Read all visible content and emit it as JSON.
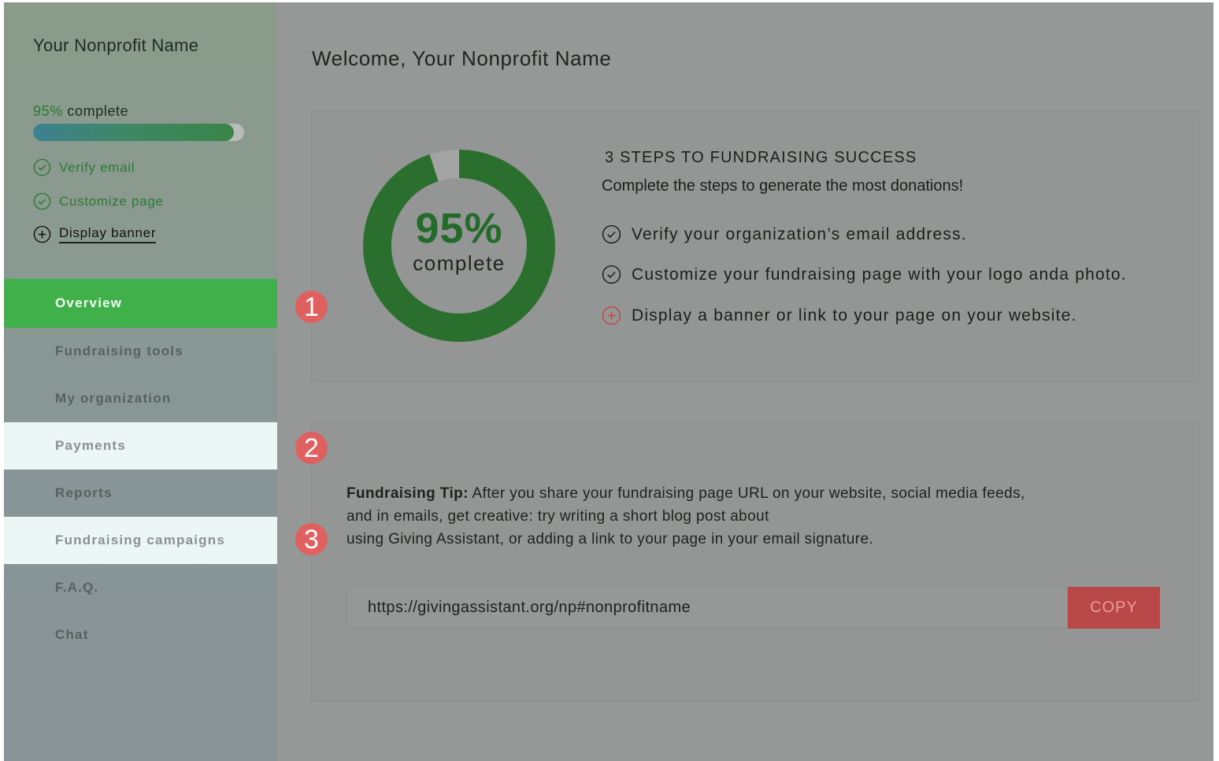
{
  "sidebar": {
    "org_name": "Your Nonprofit Name",
    "progress": {
      "percent_label": "95%",
      "suffix": " complete",
      "value": 0.95
    },
    "steps": [
      {
        "label": "Verify email",
        "status": "done",
        "icon": "check-circle-icon"
      },
      {
        "label": "Customize page",
        "status": "done",
        "icon": "check-circle-icon"
      },
      {
        "label": "Display banner",
        "status": "todo",
        "icon": "plus-circle-icon"
      }
    ],
    "nav": [
      {
        "label": "Overview",
        "state": "active"
      },
      {
        "label": "Fundraising tools",
        "state": "normal"
      },
      {
        "label": "My organization",
        "state": "normal"
      },
      {
        "label": "Payments",
        "state": "highlight"
      },
      {
        "label": "Reports",
        "state": "normal"
      },
      {
        "label": "Fundraising campaigns",
        "state": "highlight"
      },
      {
        "label": "F.A.Q.",
        "state": "normal"
      },
      {
        "label": "Chat",
        "state": "normal"
      }
    ]
  },
  "main": {
    "welcome": "Welcome, Your Nonprofit Name",
    "overview_card": {
      "donut": {
        "percent_label": "95%",
        "label": "complete",
        "value": 0.95
      },
      "title": "3 STEPS TO FUNDRAISING SUCCESS",
      "subtitle": "Complete the steps to generate the most donations!",
      "checklist": [
        {
          "text": "Verify your organization’s email address.",
          "icon": "check-circle-icon"
        },
        {
          "text": "Customize your fundraising page with your logo anda photo.",
          "icon": "check-circle-icon"
        },
        {
          "text": "Display a banner or link to your page on your website.",
          "icon": "plus-circle-icon"
        }
      ]
    },
    "tip_card": {
      "tip_label": "Fundraising Tip:",
      "tip_line1": " After you share your fundraising page URL on your website, social media feeds,",
      "tip_line2": "and in emails, get creative: try writing a short blog post about",
      "tip_line3": "using Giving Assistant, or adding a link to your page in your email signature.",
      "url": "https://givingassistant.org/np#nonprofitname",
      "copy_label": "COPY"
    },
    "badges": [
      "1",
      "2",
      "3"
    ]
  },
  "colors": {
    "accent_green": "#40b14a",
    "dark_green": "#236a2b",
    "copy_red": "#b84848",
    "badge_red": "#e06060"
  }
}
